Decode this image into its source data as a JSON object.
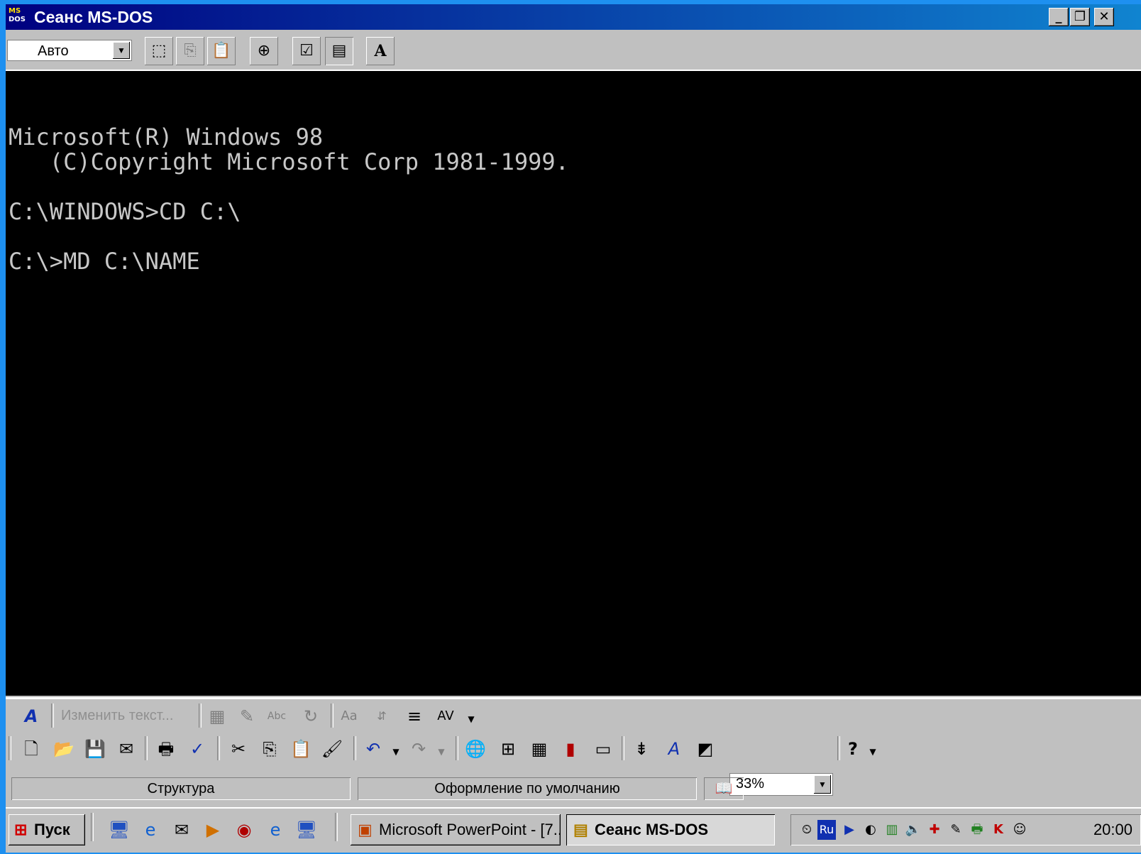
{
  "window": {
    "title": "Сеанс MS-DOS",
    "icon": "msdos-icon",
    "icon_text_top": "MS",
    "icon_text_bottom": "DOS",
    "minimize": "_",
    "maximize": "❐",
    "close": "✕"
  },
  "dos_toolbar": {
    "font_size": "Авто",
    "buttons": [
      "mark-icon",
      "copy-icon",
      "paste-icon",
      "fullscreen-icon",
      "properties-icon",
      "background-icon",
      "font-icon"
    ],
    "font_button_glyph": "A"
  },
  "console": {
    "lines": [
      "Microsoft(R) Windows 98",
      "   (C)Copyright Microsoft Corp 1981-1999.",
      "",
      "C:\\WINDOWS>CD C:\\",
      "",
      "C:\\>MD C:\\NAME"
    ]
  },
  "wordart_toolbar": {
    "edit_text": "Изменить текст..."
  },
  "standard_toolbar": {
    "zoom": "33%"
  },
  "status_bar": {
    "view": "Структура",
    "design": "Оформление по умолчанию"
  },
  "taskbar": {
    "start": "Пуск",
    "tasks": [
      {
        "label": "Microsoft PowerPoint - [7..."
      },
      {
        "label": "Сеанс MS-DOS"
      }
    ],
    "tray_lang": "Ru",
    "clock": "20:00"
  },
  "colors": {
    "desktop": "#1e90f0",
    "title_start": "#000080",
    "title_end": "#1084d0",
    "console_bg": "#000000",
    "console_fg": "#c8c8c8"
  }
}
